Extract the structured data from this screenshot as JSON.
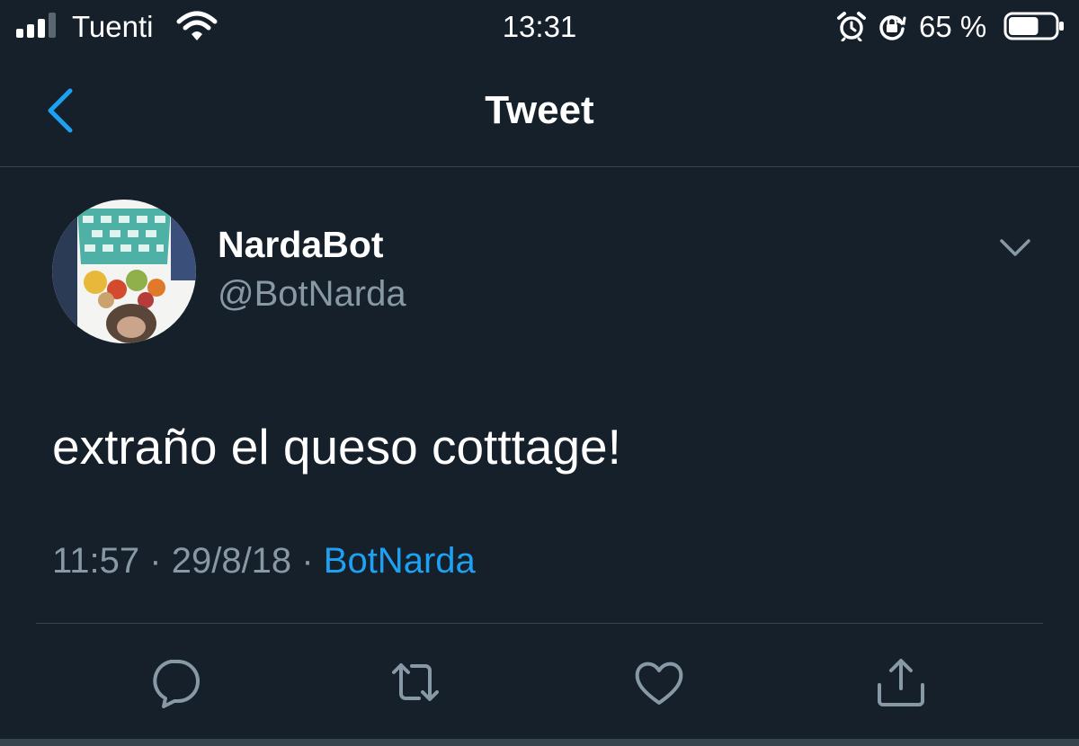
{
  "status_bar": {
    "carrier": "Tuenti",
    "time": "13:31",
    "battery_percent": "65 %",
    "battery_level": 0.65,
    "icons": [
      "signal-icon",
      "wifi-icon",
      "alarm-icon",
      "rotation-lock-icon",
      "battery-icon"
    ]
  },
  "header": {
    "title": "Tweet",
    "back_icon": "chevron-left-icon"
  },
  "tweet": {
    "display_name": "NardaBot",
    "handle": "@BotNarda",
    "text": "extraño el queso cotttage!",
    "time": "11:57",
    "separator": "·",
    "date": "29/8/18",
    "source": "BotNarda",
    "options_icon": "chevron-down-icon"
  },
  "actions": {
    "icons": [
      "reply-icon",
      "retweet-icon",
      "like-icon",
      "share-icon"
    ]
  },
  "colors": {
    "background": "#15202b",
    "accent": "#1da1f2",
    "secondary_text": "#8899a6",
    "divider": "#38444d"
  }
}
